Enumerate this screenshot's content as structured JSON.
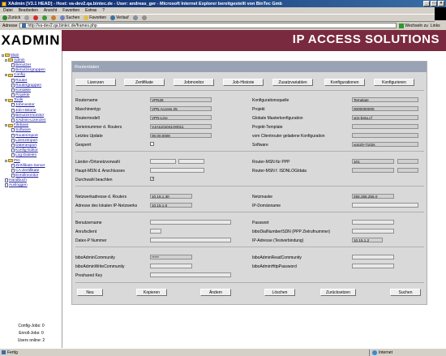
{
  "window": {
    "title": "XAdmin [V3.1 HEAD] - Host: va-dev2.qa.bintec.de - User: andreas_ger - Microsoft Internet Explorer bereitgestellt von BinTec Gmb",
    "min": "_",
    "max": "□",
    "close": "×"
  },
  "menu": [
    "Datei",
    "Bearbeiten",
    "Ansicht",
    "Favoriten",
    "Extras",
    "?"
  ],
  "toolbar": {
    "back": "Zurück",
    "forward": "→",
    "search": "Suchen",
    "favorites": "Favoriten",
    "history": "Verlauf"
  },
  "address": {
    "label": "Adresse",
    "url": "http://va-dev2.qa.bintec.de/frames.php",
    "go": "Wechseln zu",
    "links": "Links"
  },
  "brand": {
    "logo": "XADMIN",
    "title": "IP ACCESS SOLUTIONS"
  },
  "sidebar": {
    "tree": [
      {
        "label": "Main",
        "level": 0,
        "type": "folder"
      },
      {
        "label": "Admin",
        "level": 1,
        "type": "folder"
      },
      {
        "label": "Benutzer",
        "level": 2,
        "type": "doc"
      },
      {
        "label": "Benutzergruppen",
        "level": 2,
        "type": "doc"
      },
      {
        "label": "Config",
        "level": 1,
        "type": "folder"
      },
      {
        "label": "Router",
        "level": 2,
        "type": "doc"
      },
      {
        "label": "Routergruppen",
        "level": 2,
        "type": "doc"
      },
      {
        "label": "Kontakte",
        "level": 2,
        "type": "doc"
      },
      {
        "label": "Projekte",
        "level": 2,
        "type": "doc"
      },
      {
        "label": "Tools",
        "level": 1,
        "type": "folder"
      },
      {
        "label": "Jobmonitor",
        "level": 2,
        "type": "doc"
      },
      {
        "label": "Job-Historie",
        "level": 2,
        "type": "doc"
      },
      {
        "label": "Benutzermonitor",
        "level": 2,
        "type": "doc"
      },
      {
        "label": "XAdmin-Lizenzen",
        "level": 2,
        "type": "doc"
      },
      {
        "label": "Filebase",
        "level": 1,
        "type": "folder"
      },
      {
        "label": "Software",
        "level": 2,
        "type": "doc"
      },
      {
        "label": "Routerimport",
        "level": 2,
        "type": "doc"
      },
      {
        "label": "Lizenzimport",
        "level": 2,
        "type": "doc"
      },
      {
        "label": "Datenexport",
        "level": 2,
        "type": "doc"
      },
      {
        "label": "Konfig-Editor",
        "level": 2,
        "type": "doc"
      },
      {
        "label": "Log-Dateien",
        "level": 2,
        "type": "doc"
      },
      {
        "label": "PKI",
        "level": 1,
        "type": "folder"
      },
      {
        "label": "Zertifikats-Server",
        "level": 2,
        "type": "doc"
      },
      {
        "label": "CA-Zertifikate",
        "level": 2,
        "type": "doc"
      },
      {
        "label": "Enrollmonitor",
        "level": 2,
        "type": "doc"
      },
      {
        "label": "Handbuch",
        "level": 1,
        "type": "doc"
      },
      {
        "label": "Ausloggen",
        "level": 1,
        "type": "doc"
      }
    ],
    "stats": [
      "Config-Jobs: 0",
      "Enroll-Jobs: 0",
      "Users online: 2"
    ]
  },
  "panel": {
    "title": "Routerdaten",
    "top_buttons": [
      "Lizenzen",
      "Zertifikate",
      "Jobmonitor",
      "Job-Historie",
      "Zusatzvariablen",
      "Konfigurationen",
      "Konfigurieren"
    ],
    "bottom_buttons": [
      "Neu",
      "Kopieren",
      "Ändern",
      "Löschen",
      "Zurücksetzen",
      "Suchen"
    ],
    "fields": {
      "routername": {
        "label": "Routername",
        "value": "VPN25"
      },
      "konfigquelle": {
        "label": "Konfigurationsquelle",
        "value": "Template"
      },
      "maschinentyp": {
        "label": "Maschinentyp",
        "value": "VPN Access 25"
      },
      "projekt": {
        "label": "Projekt",
        "value": "0000000000"
      },
      "routermodell": {
        "label": "Routermodell",
        "value": "VPN-Line"
      },
      "globalmaster": {
        "label": "Globale Masterkonfiguration",
        "value": "vpn-beta.cf"
      },
      "seriennummer": {
        "label": "Seriennummer d. Routers",
        "value": "VJA1101041O0011"
      },
      "projtemplate": {
        "label": "Projekt-Template",
        "value": ""
      },
      "letztesupdate": {
        "label": "Letztes Update",
        "value": "00.00.0000"
      },
      "vomclient": {
        "label": "vom Clientrouter geladene Konfiguration",
        "value": ""
      },
      "gesperrt": {
        "label": "Gesperrt",
        "value": ""
      },
      "software": {
        "label": "Software",
        "value": "vgn20-7102s"
      },
      "laendervorwahl": {
        "label": "Länder-/Ortsnetzvorwahl",
        "value": ""
      },
      "routermsnppp": {
        "label": "Router-MSN für PPP",
        "value": "101"
      },
      "hauptmsn": {
        "label": "Haupt-MSN d. Anschlusses",
        "value": ""
      },
      "routermsnisdn": {
        "label": "Router-MSN f. ISDNLOGIdata",
        "value": ""
      },
      "durchwahl": {
        "label": "Durchwahl beachten",
        "value": "✓"
      },
      "netzwerkadresse": {
        "label": "Netzwerkadresse d. Routers",
        "value": "10.15.1.30"
      },
      "netzmaske": {
        "label": "Netzmaske",
        "value": "255.255.255.0"
      },
      "lokaladresse": {
        "label": "Adresse des lokalen IP-Netzwerks",
        "value": "10.15.1.0"
      },
      "domainname": {
        "label": "IP-Domänname",
        "value": ""
      },
      "benutzername": {
        "label": "Benutzername",
        "value": ""
      },
      "passwort": {
        "label": "Passwort",
        "value": ""
      },
      "anrufsclient": {
        "label": "Anrufsclient",
        "value": ""
      },
      "bibodial": {
        "label": "biboDialNumberISDN (PPP Zielrufnummer)",
        "value": ""
      },
      "dateipnummer": {
        "label": "Datex-P Nummer",
        "value": ""
      },
      "ipadresstest": {
        "label": "IP-Adresse (Testverbindung)",
        "value": "10.15.1.2"
      },
      "adminreadcomm": {
        "label": "biboAdminCommunity",
        "value": "*****"
      },
      "readcomm": {
        "label": "biboAdminReadCommunity",
        "value": ""
      },
      "writecomm": {
        "label": "biboAdminWriteCommunity",
        "value": ""
      },
      "httppass": {
        "label": "biboAdminHttpPassword",
        "value": ""
      },
      "presharedkey": {
        "label": "Preshared Key",
        "value": ""
      }
    }
  },
  "status": {
    "left": "Fertig",
    "right": "Internet"
  },
  "colors": {
    "brand": "#7a2a3e",
    "panel_head": "#9aa3b5",
    "panel": "#d9d9d9",
    "titlebar": "#0a246a"
  }
}
